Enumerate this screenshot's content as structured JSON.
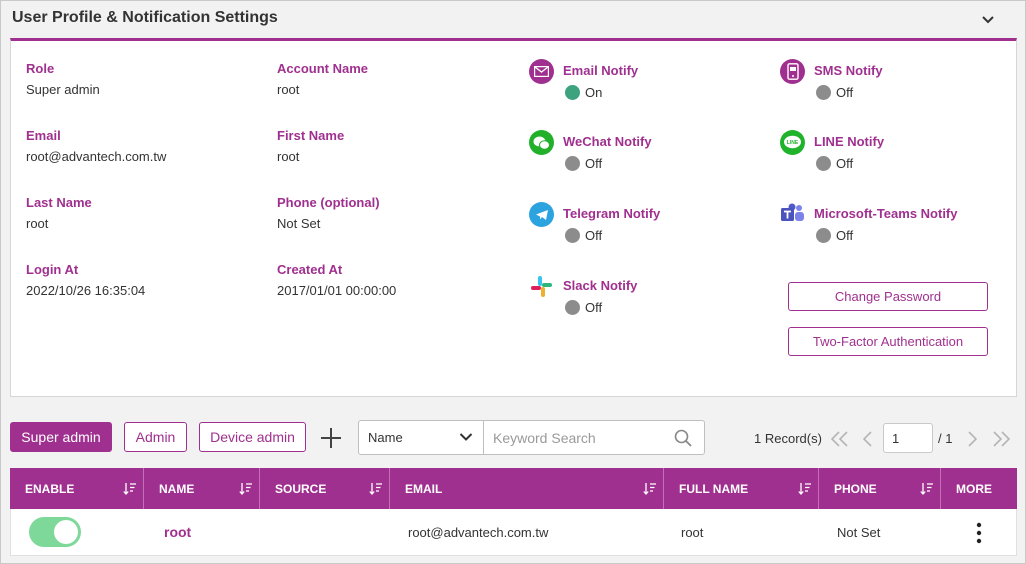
{
  "panel": {
    "title": "User Profile & Notification Settings"
  },
  "profile": {
    "role": {
      "label": "Role",
      "value": "Super admin"
    },
    "account_name": {
      "label": "Account Name",
      "value": "root"
    },
    "email": {
      "label": "Email",
      "value": "root@advantech.com.tw"
    },
    "first_name": {
      "label": "First Name",
      "value": "root"
    },
    "last_name": {
      "label": "Last Name",
      "value": "root"
    },
    "phone": {
      "label": "Phone (optional)",
      "value": "Not Set"
    },
    "login_at": {
      "label": "Login At",
      "value": "2022/10/26 16:35:04"
    },
    "created_at": {
      "label": "Created At",
      "value": "2017/01/01 00:00:00"
    }
  },
  "notifications": {
    "email": {
      "label": "Email Notify",
      "status": "On",
      "icon": "envelope-icon"
    },
    "sms": {
      "label": "SMS Notify",
      "status": "Off",
      "icon": "sms-icon"
    },
    "wechat": {
      "label": "WeChat Notify",
      "status": "Off",
      "icon": "wechat-icon"
    },
    "line": {
      "label": "LINE Notify",
      "status": "Off",
      "icon": "line-icon"
    },
    "telegram": {
      "label": "Telegram Notify",
      "status": "Off",
      "icon": "telegram-icon"
    },
    "teams": {
      "label": "Microsoft-Teams Notify",
      "status": "Off",
      "icon": "teams-icon"
    },
    "slack": {
      "label": "Slack Notify",
      "status": "Off",
      "icon": "slack-icon"
    }
  },
  "actions": {
    "change_password": "Change Password",
    "two_factor": "Two-Factor Authentication"
  },
  "toolbar": {
    "tabs": [
      "Super admin",
      "Admin",
      "Device admin"
    ],
    "active_tab": "Super admin",
    "search_field": "Name",
    "search_placeholder": "Keyword Search",
    "record_count": "1 Record(s)",
    "page": "1",
    "page_total": "/ 1"
  },
  "table": {
    "headers": [
      "ENABLE",
      "NAME",
      "SOURCE",
      "EMAIL",
      "FULL NAME",
      "PHONE",
      "MORE"
    ],
    "rows": [
      {
        "enable": true,
        "name": "root",
        "source": "",
        "email": "root@advantech.com.tw",
        "full_name": "root",
        "phone": "Not Set"
      }
    ]
  },
  "colors": {
    "accent": "#a0308f",
    "on": "#3da37e",
    "off": "#8c8c8c",
    "toggle_on": "#7dd89a"
  }
}
